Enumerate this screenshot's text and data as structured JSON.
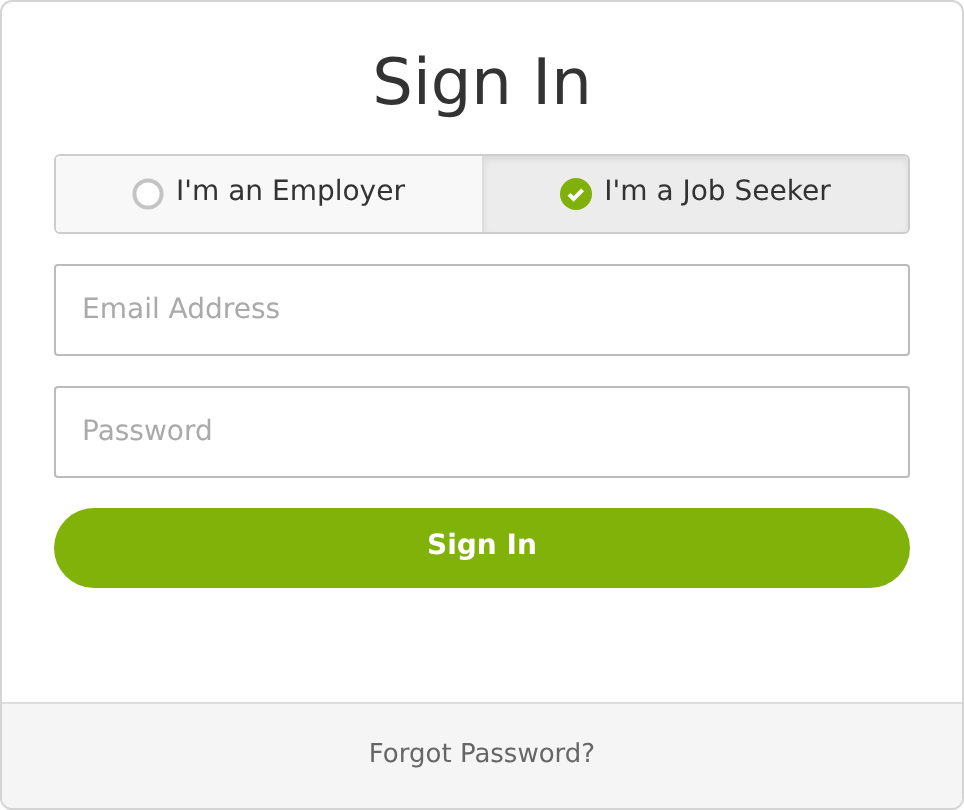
{
  "title": "Sign In",
  "roles": [
    {
      "label": "I'm an Employer",
      "selected": false
    },
    {
      "label": "I'm a Job Seeker",
      "selected": true
    }
  ],
  "email": {
    "placeholder": "Email Address"
  },
  "password": {
    "placeholder": "Password"
  },
  "submit": "Sign In",
  "footer_link": "Forgot Password?"
}
